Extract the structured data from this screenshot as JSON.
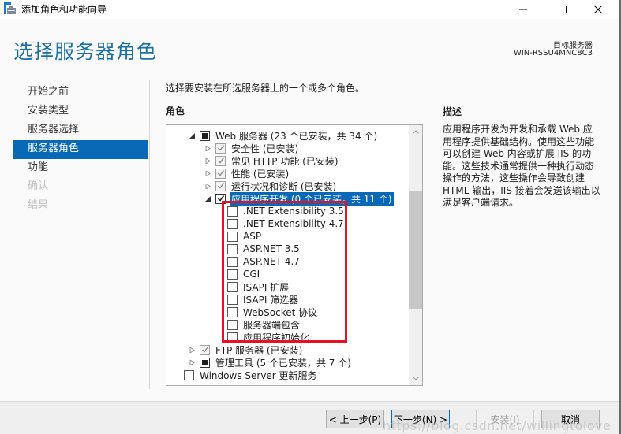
{
  "window": {
    "title": "添加角色和功能向导",
    "icon": "server-manager-icon",
    "controls": {
      "minimize": "minimize-icon",
      "maximize": "maximize-icon",
      "close": "close-icon"
    }
  },
  "header": {
    "page_title": "选择服务器角色",
    "target_label": "目标服务器",
    "target_value": "WIN-RSSU4MNC8C3"
  },
  "nav": {
    "items": [
      {
        "label": "开始之前",
        "state": "normal"
      },
      {
        "label": "安装类型",
        "state": "normal"
      },
      {
        "label": "服务器选择",
        "state": "normal"
      },
      {
        "label": "服务器角色",
        "state": "active"
      },
      {
        "label": "功能",
        "state": "normal"
      },
      {
        "label": "确认",
        "state": "disabled"
      },
      {
        "label": "结果",
        "state": "disabled"
      }
    ]
  },
  "main": {
    "intro": "选择要安装在所选服务器上的一个或多个角色。",
    "roles_heading": "角色",
    "tree": [
      {
        "label": "Web 服务器 (23 个已安装，共 34 个)",
        "level": 1,
        "expander": "expanded",
        "check": "partial"
      },
      {
        "label": "安全性 (已安装)",
        "level": 2,
        "expander": "collapsed",
        "check": "checked-gray"
      },
      {
        "label": "常见 HTTP 功能 (已安装)",
        "level": 2,
        "expander": "collapsed",
        "check": "checked-gray"
      },
      {
        "label": "性能 (已安装)",
        "level": 2,
        "expander": "collapsed",
        "check": "checked-gray"
      },
      {
        "label": "运行状况和诊断 (已安装)",
        "level": 2,
        "expander": "collapsed",
        "check": "checked-gray"
      },
      {
        "label": "应用程序开发 (0 个已安装，共 11 个)",
        "level": 2,
        "expander": "expanded",
        "check": "checked",
        "selected": true
      },
      {
        "label": ".NET Extensibility 3.5",
        "level": 3,
        "expander": "none",
        "check": "unchecked"
      },
      {
        "label": ".NET Extensibility 4.7",
        "level": 3,
        "expander": "none",
        "check": "unchecked"
      },
      {
        "label": "ASP",
        "level": 3,
        "expander": "none",
        "check": "unchecked"
      },
      {
        "label": "ASP.NET 3.5",
        "level": 3,
        "expander": "none",
        "check": "unchecked"
      },
      {
        "label": "ASP.NET 4.7",
        "level": 3,
        "expander": "none",
        "check": "unchecked"
      },
      {
        "label": "CGI",
        "level": 3,
        "expander": "none",
        "check": "unchecked"
      },
      {
        "label": "ISAPI 扩展",
        "level": 3,
        "expander": "none",
        "check": "unchecked"
      },
      {
        "label": "ISAPI 筛选器",
        "level": 3,
        "expander": "none",
        "check": "unchecked"
      },
      {
        "label": "WebSocket 协议",
        "level": 3,
        "expander": "none",
        "check": "unchecked"
      },
      {
        "label": "服务器端包含",
        "level": 3,
        "expander": "none",
        "check": "unchecked"
      },
      {
        "label": "应用程序初始化",
        "level": 3,
        "expander": "none",
        "check": "unchecked"
      },
      {
        "label": "FTP 服务器 (已安装)",
        "level": 1,
        "expander": "collapsed",
        "check": "checked-gray"
      },
      {
        "label": "管理工具 (5 个已安装，共 7 个)",
        "level": 1,
        "expander": "collapsed",
        "check": "partial"
      },
      {
        "label": "Windows Server 更新服务",
        "level": 0,
        "expander": "none",
        "check": "unchecked"
      }
    ],
    "scroll_position": 0.35
  },
  "description": {
    "heading": "描述",
    "text": "应用程序开发为开发和承载 Web 应用程序提供基础结构。使用这些功能可以创建 Web 内容或扩展 IIS 的功能。这些技术通常提供一种执行动态操作的方法，这些操作会导致创建 HTML 输出，IIS 接着会发送该输出以满足客户端请求。"
  },
  "footer": {
    "prev": "< 上一步(P)",
    "next": "下一步(N) >",
    "install": "安装(I)",
    "cancel": "取消"
  },
  "watermark": "https://blog.csdn.net/willingtolove",
  "colors": {
    "accent": "#0a69b6",
    "title": "#1a6fa3",
    "highlight": "#e81123"
  }
}
